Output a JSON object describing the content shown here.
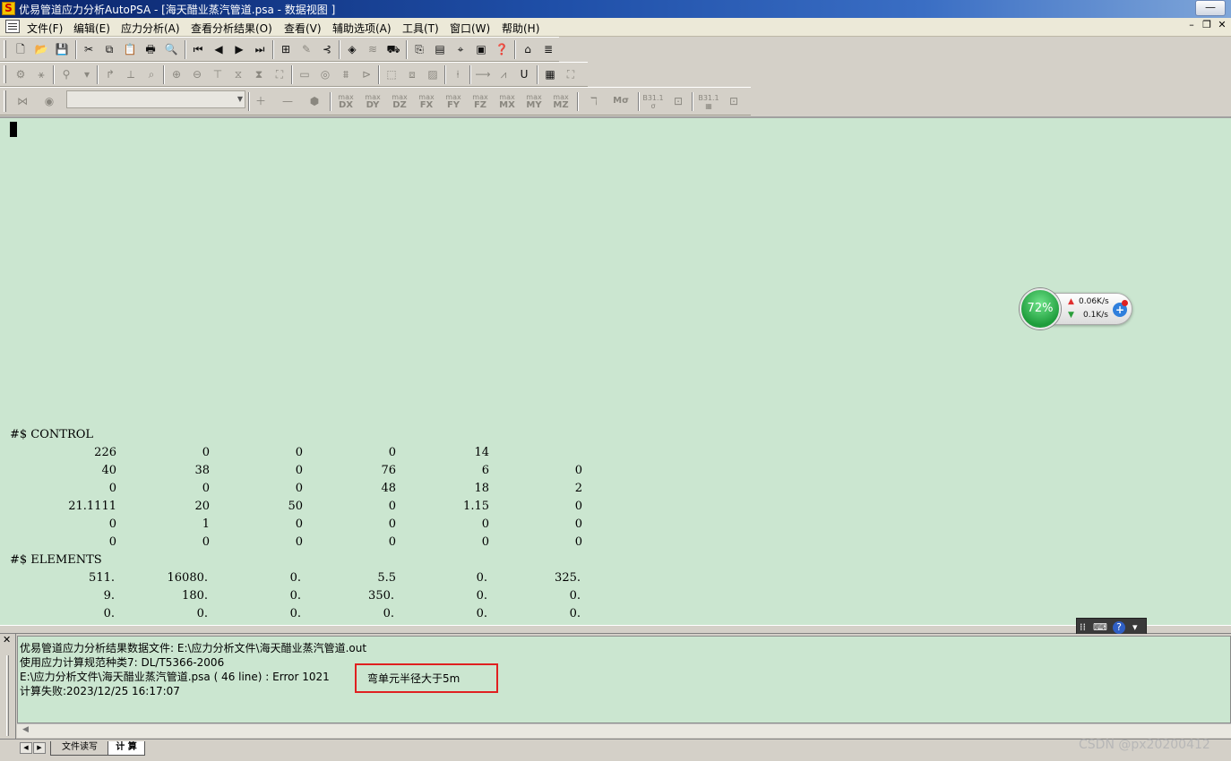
{
  "window": {
    "title": "优易管道应力分析AutoPSA - [海天醋业蒸汽管道.psa - 数据视图 ]",
    "minimize_label": "—",
    "maximize_label": "▭",
    "close_label": "✕"
  },
  "menu": [
    "文件(F)",
    "编辑(E)",
    "应力分析(A)",
    "查看分析结果(O)",
    "查看(V)",
    "辅助选项(A)",
    "工具(T)",
    "窗口(W)",
    "帮助(H)"
  ],
  "toolbar3_labels": {
    "dx": "DX",
    "dy": "DY",
    "dz": "DZ",
    "fx": "FX",
    "fy": "FY",
    "fz": "FZ",
    "mx": "MX",
    "my": "MY",
    "mz": "MZ",
    "max": "max",
    "m_sigma": "Mσ",
    "b311": "B31.1"
  },
  "editor": {
    "control_header": "#$ CONTROL",
    "control_rows": [
      [
        "226",
        "0",
        "0",
        "0",
        "14",
        ""
      ],
      [
        "40",
        "38",
        "0",
        "76",
        "6",
        "0"
      ],
      [
        "0",
        "0",
        "0",
        "48",
        "18",
        "2"
      ],
      [
        "21.1111",
        "20",
        "50",
        "0",
        "1.15",
        "0"
      ],
      [
        "0",
        "1",
        "0",
        "0",
        "0",
        "0"
      ],
      [
        "0",
        "0",
        "0",
        "0",
        "0",
        "0"
      ]
    ],
    "elements_header": "#$ ELEMENTS",
    "elements_rows": [
      [
        "511.",
        "16080.",
        "0.",
        "5.5",
        "0.",
        "325."
      ],
      [
        "9.",
        "180.",
        "0.",
        "350.",
        "0.",
        "0."
      ],
      [
        "0.",
        "0.",
        "0.",
        "0.",
        "0.",
        "0."
      ]
    ]
  },
  "net_widget": {
    "percent": "72%",
    "upload": "0.06K/s",
    "download": "0.1K/s"
  },
  "output": {
    "lines": [
      "优易管道应力分析结果数据文件: E:\\应力分析文件\\海天醋业蒸汽管道.out",
      "使用应力计算规范种类7: DL/T5366-2006",
      "E:\\应力分析文件\\海天醋业蒸汽管道.psa (   46 line) : Error  1021",
      "计算失败:2023/12/25  16:17:07"
    ],
    "error_message": "弯单元半径大于5m"
  },
  "tabs": [
    {
      "label": "文件读写",
      "active": false
    },
    {
      "label": "计 算",
      "active": true
    }
  ],
  "watermark": "CSDN @px20200412"
}
